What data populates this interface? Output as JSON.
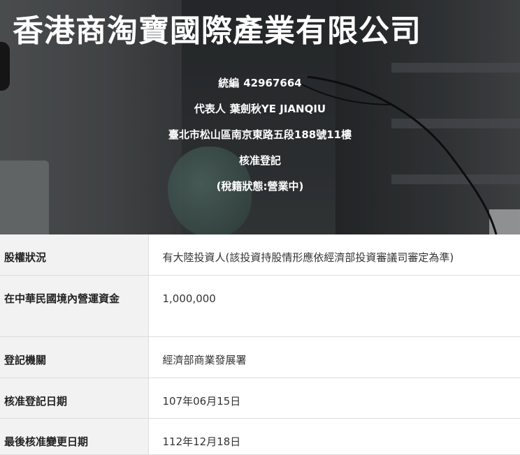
{
  "company": {
    "name": "香港商淘寶國際產業有限公司",
    "tax_id_label": "統編",
    "tax_id": "42967664",
    "representative_label": "代表人",
    "representative": "葉劍秋YE JIANQIU",
    "address": "臺北市松山區南京東路五段188號11樓",
    "status": "核准登記",
    "tax_status": "(稅籍狀態:營業中)"
  },
  "details": {
    "rows": [
      {
        "label": "股權狀況",
        "value": "有大陸投資人(該投資持股情形應依經濟部投資審議司審定為準)"
      },
      {
        "label": "在中華民國境內營運資金",
        "value": "1,000,000"
      },
      {
        "label": "登記機關",
        "value": "經濟部商業發展署"
      },
      {
        "label": "核准登記日期",
        "value": "107年06月15日"
      },
      {
        "label": "最後核准變更日期",
        "value": "112年12月18日"
      }
    ]
  }
}
